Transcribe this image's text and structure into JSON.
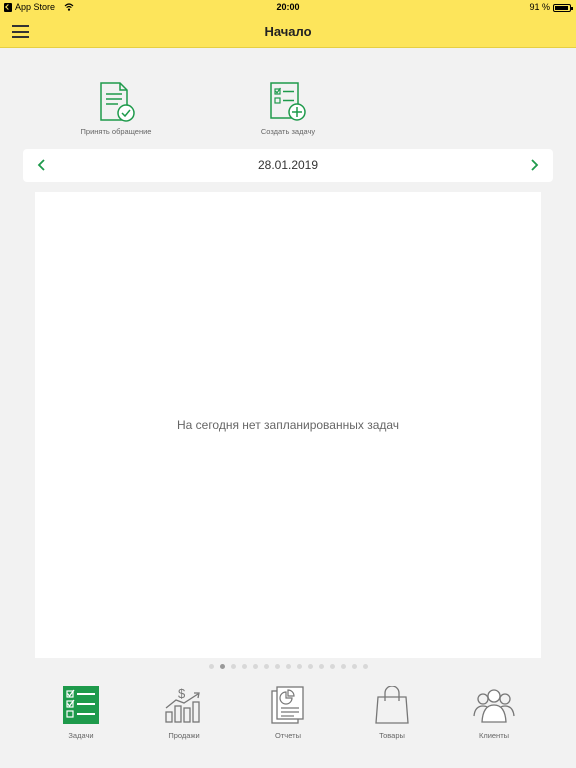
{
  "status_bar": {
    "back_app": "App Store",
    "time": "20:00",
    "battery": "91 %",
    "battery_level": 0.91
  },
  "nav": {
    "title": "Начало",
    "menu_icon": "hamburger-icon"
  },
  "actions": [
    {
      "label": "Принять обращение",
      "icon": "document-check-icon"
    },
    {
      "label": "Создать задачу",
      "icon": "task-add-icon"
    }
  ],
  "date_bar": {
    "date": "28.01.2019",
    "prev_icon": "chevron-left-icon",
    "next_icon": "chevron-right-icon"
  },
  "content": {
    "empty_message": "На сегодня нет запланированных задач"
  },
  "pager": {
    "count": 15,
    "active_index": 1
  },
  "tabs": [
    {
      "label": "Задачи",
      "icon": "tasks-icon",
      "active": true
    },
    {
      "label": "Продажи",
      "icon": "sales-chart-icon",
      "active": false
    },
    {
      "label": "Отчеты",
      "icon": "reports-icon",
      "active": false
    },
    {
      "label": "Товары",
      "icon": "shopping-bag-icon",
      "active": false
    },
    {
      "label": "Клиенты",
      "icon": "clients-icon",
      "active": false
    }
  ],
  "colors": {
    "brand_yellow": "#fde55b",
    "accent_green": "#1e9a4b",
    "icon_gray": "#777777"
  }
}
